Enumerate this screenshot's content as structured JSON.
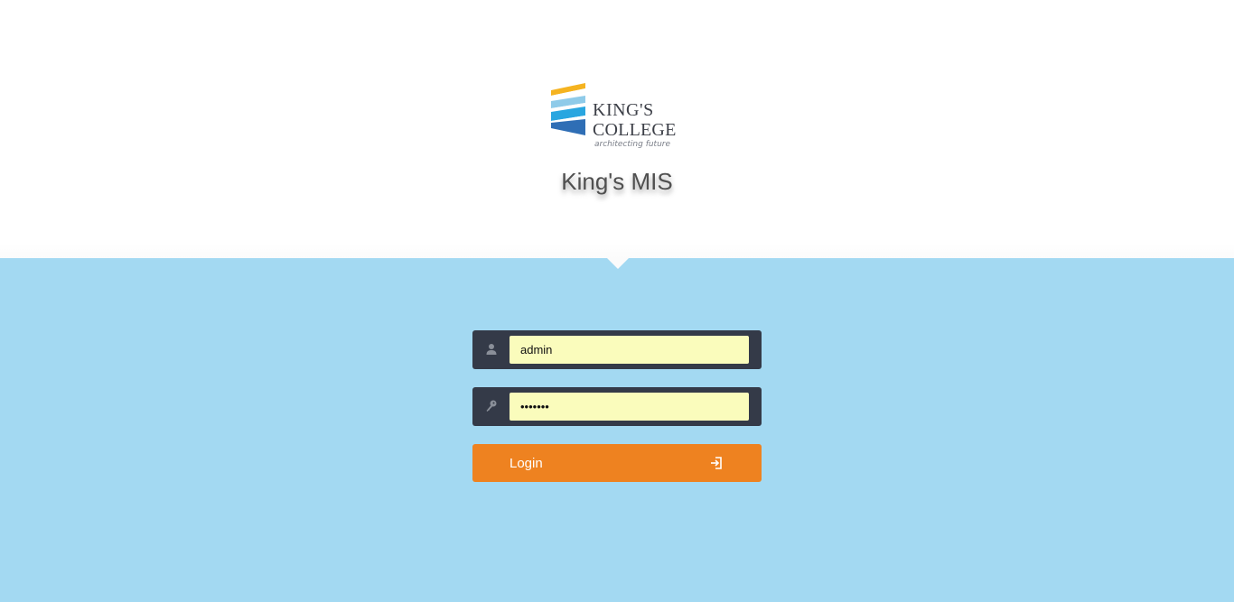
{
  "logo": {
    "line1": "KING'S",
    "line2": "COLLEGE",
    "tagline": "architecting future",
    "colors": [
      "#f5b320",
      "#8fcbe9",
      "#29a6e0",
      "#2f6eb5"
    ]
  },
  "app_title": "King's MIS",
  "login_form": {
    "username": {
      "value": "admin",
      "icon": "user-icon"
    },
    "password": {
      "value": "•••••••",
      "icon": "key-icon"
    },
    "login_button": {
      "label": "Login",
      "icon": "sign-in-icon"
    }
  },
  "colors": {
    "background": "#a3d9f2",
    "header": "#ffffff",
    "field_bg": "#343a48",
    "input_bg": "#fafcbc",
    "button": "#ee8220"
  }
}
